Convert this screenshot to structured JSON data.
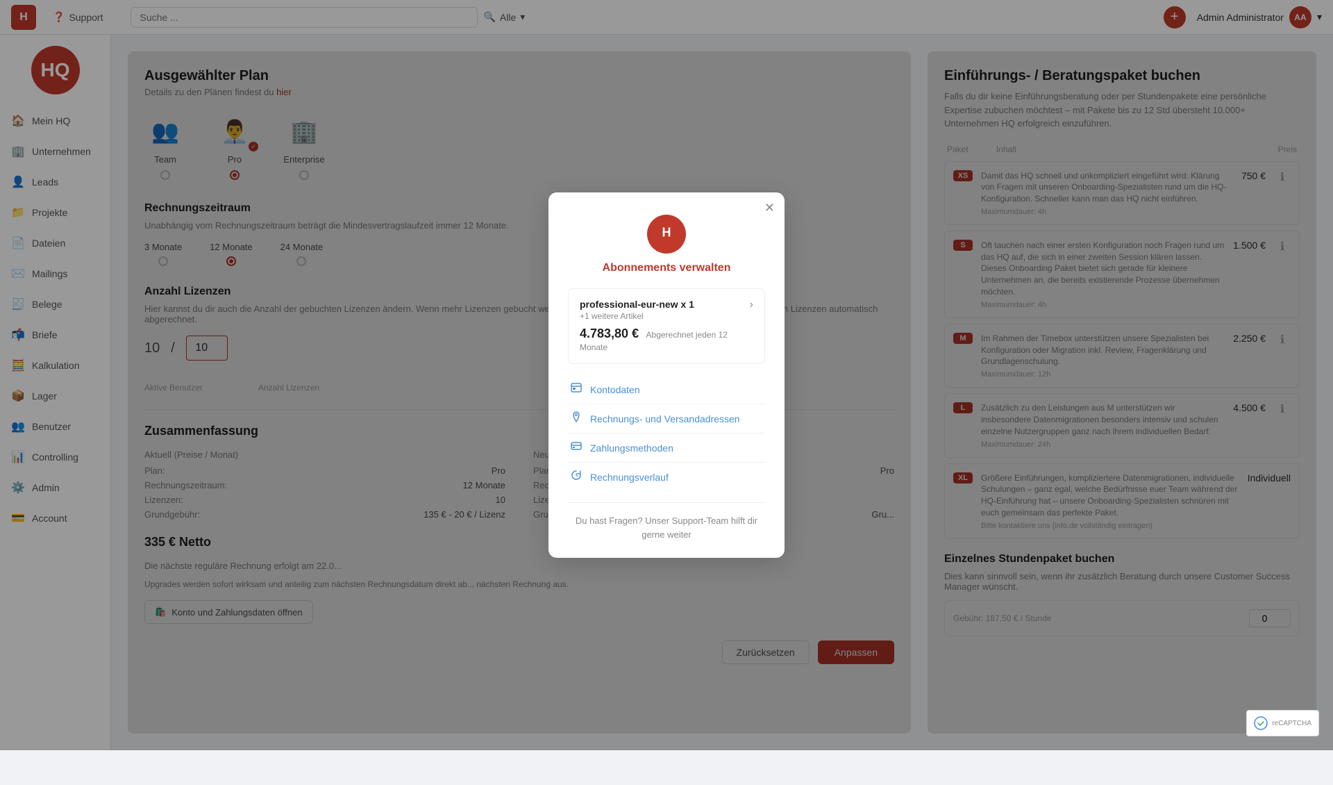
{
  "app": {
    "logo_text": "HQ",
    "logo_text_small": "H"
  },
  "topnav": {
    "support_label": "Support",
    "search_placeholder": "Suche ...",
    "search_filter_label": "Alle",
    "add_button_label": "+",
    "user_name": "Admin Administrator",
    "user_initials": "AA"
  },
  "sidebar": {
    "logo_text": "HQ.",
    "items": [
      {
        "id": "mein-hq",
        "label": "Mein HQ",
        "icon": "🏠"
      },
      {
        "id": "unternehmen",
        "label": "Unternehmen",
        "icon": "🏢"
      },
      {
        "id": "leads",
        "label": "Leads",
        "icon": "👤",
        "active": true
      },
      {
        "id": "projekte",
        "label": "Projekte",
        "icon": "📁"
      },
      {
        "id": "dateien",
        "label": "Dateien",
        "icon": "📄"
      },
      {
        "id": "mailings",
        "label": "Mailings",
        "icon": "✉️"
      },
      {
        "id": "belege",
        "label": "Belege",
        "icon": "🧾"
      },
      {
        "id": "briefe",
        "label": "Briefe",
        "icon": "📬"
      },
      {
        "id": "kalkulation",
        "label": "Kalkulation",
        "icon": "🧮"
      },
      {
        "id": "lager",
        "label": "Lager",
        "icon": "📦"
      },
      {
        "id": "benutzer",
        "label": "Benutzer",
        "icon": "👥"
      },
      {
        "id": "controlling",
        "label": "Controlling",
        "icon": "📊"
      },
      {
        "id": "admin",
        "label": "Admin",
        "icon": "⚙️"
      },
      {
        "id": "account",
        "label": "Account",
        "icon": "💳"
      }
    ]
  },
  "left_panel": {
    "title": "Ausgewählter Plan",
    "subtitle_text": "Details zu den Plänen findest du",
    "subtitle_link": "hier",
    "plans": [
      {
        "id": "team",
        "label": "Team",
        "icon": "👥",
        "selected": false
      },
      {
        "id": "pro",
        "label": "Pro",
        "icon": "👨‍💼",
        "selected": true
      },
      {
        "id": "enterprise",
        "label": "Enterprise",
        "icon": "🏢",
        "selected": false
      }
    ],
    "billing_period_title": "Rechnungszeitraum",
    "billing_period_desc": "Unabhängig vom Rechnungszeitraum beträgt die Mindesvertragslaufzeit immer 12 Monate.",
    "billing_periods": [
      {
        "id": "3months",
        "label": "3 Monate",
        "selected": false
      },
      {
        "id": "12months",
        "label": "12 Monate",
        "selected": true
      },
      {
        "id": "24months",
        "label": "24 Monate",
        "selected": false
      }
    ],
    "license_title": "Anzahl Lizenzen",
    "license_desc": "Hier kannst du dir auch die Anzahl der gebuchten Lizenzen ändern. Wenn mehr Lizenzen gebucht werden als Benutzer vorhanden sind, werden die überzähligen Lizenzen automatisch abgerechnet.",
    "active_users": "10",
    "license_count": "10",
    "active_users_label": "Aktive Benutzer",
    "license_count_label": "Anzahl Lizenzen",
    "summary_title": "Zusammenfassung",
    "current_col_title": "Aktuell (Preise / Monat)",
    "new_col_title": "Neu (Preise / Monat)",
    "current_plan_label": "Plan:",
    "current_plan_value": "Pro",
    "current_period_label": "Rechnungszeitraum:",
    "current_period_value": "12 Monate",
    "current_licenses_label": "Lizenzen:",
    "current_licenses_value": "10",
    "current_base_label": "Grundgebühr:",
    "current_base_value": "135 € - 20 € / Lizenz",
    "new_plan_label": "Plan:",
    "new_plan_value": "Pro",
    "new_period_label": "Rechnungszeitraum:",
    "new_period_value": "",
    "new_licenses_label": "Lizenzen:",
    "new_licenses_value": "",
    "new_base_label": "Grundgebühr:",
    "new_base_value": "Gru...",
    "total": "335 € Netto",
    "next_invoice_text": "Die nächste reguläre Rechnung erfolgt am 22.0...",
    "upgrade_note": "Upgrades werden sofort wirksam und anteilig zum nächsten Rechnungsdatum direkt ab... nächsten Rechnung aus.",
    "konto_btn_label": "Konto und Zahlungsdaten öffnen",
    "btn_reset": "Zurücksetzen",
    "btn_save": "Anpassen"
  },
  "right_panel": {
    "title": "Einführungs- / Beratungspaket buchen",
    "desc": "Falls du dir keine Einführungsberatung oder per Stundenpakete eine persönliche Expertise zubuchen möchtest – mit Pakete bis zu 12 Std übersteht 10.000+ Unternehmen HQ erfolgreich einzuführen.",
    "table_headers": [
      "Paket",
      "Inhalt",
      "Preis"
    ],
    "packages": [
      {
        "badge": "XS",
        "title": "Damit das HQ schnell und unkompliziert eingeführt wird: Klärung von Fragen mit unseren Onboarding-Spezialisten rund um die HQ-Konfiguration. Schneller kann man das HQ nicht einführen.",
        "max": "Maximumdauer: 4h",
        "price": "750 €",
        "color": "#c0392b"
      },
      {
        "badge": "S",
        "title": "Oft tauchen nach einer ersten Konfiguration noch Fragen rund um das HQ auf, die sich in einer zweiten Session klären lassen. Dieses Onboarding Paket bietet sich gerade für kleinere Unternehmen an, die bereits existierende Prozesse übernehmen möchten.",
        "max": "Maximumdauer: 4h",
        "price": "1.500 €",
        "color": "#c0392b"
      },
      {
        "badge": "M",
        "title": "Im Rahmen der Timebox unterstützen unsere Spezialisten bei Konfiguration oder Migration inkl. Review, Fragenklärung und Grundlagenschulung.",
        "max": "Maximumdauer: 12h",
        "price": "2.250 €",
        "color": "#c0392b"
      },
      {
        "badge": "L",
        "title": "Zusätzlich zu den Leistungen aus M unterstützen wir insbesondere Datenmigrationen besonders intensiv und schulen einzelne Nutzergruppen ganz nach ihrem individuellen Bedarf.",
        "max": "Maximumdauer: 24h",
        "price": "4.500 €",
        "color": "#c0392b"
      },
      {
        "badge": "XL",
        "title": "Größere Einführungen, kompliziertere Datenmigrationen, individuelle Schulungen – ganz egal, welche Bedürfnisse euer Team während der HQ-Einführung hat – unsere Onboarding-Spezialisten schnüren mit euch gemeinsam das perfekte Paket.",
        "max": "Bitte kontaktiere uns (info.de vollständig eintragen)",
        "price": "Individuell",
        "color": "#c0392b"
      }
    ],
    "single_hours_title": "Einzelnes Stundenpaket buchen",
    "single_hours_desc": "Dies kann sinnvoll sein, wenn ihr zusätzlich Beratung durch unsere Customer Success Manager wünscht.",
    "single_hours_sub": "Gebühr: 187,50 € / Stunde",
    "hours_input_value": "0"
  },
  "modal": {
    "logo_text": "H",
    "title": "Abonnements verwalten",
    "subscription": {
      "name": "professional-eur-new x 1",
      "extra": "+1 weitere Artikel",
      "price": "4.783,80 €",
      "period": "Abgerechnet jeden 12 Monate"
    },
    "menu_items": [
      {
        "id": "kontodaten",
        "label": "Kontodaten",
        "icon": "📋"
      },
      {
        "id": "rechnungs-versand",
        "label": "Rechnungs- und Versandadressen",
        "icon": "📍"
      },
      {
        "id": "zahlungsmethoden",
        "label": "Zahlungsmethoden",
        "icon": "💳"
      },
      {
        "id": "rechnungsverlauf",
        "label": "Rechnungsverlauf",
        "icon": "🔄"
      }
    ],
    "footer_text": "Du hast Fragen? Unser Support-Team hilft dir gerne weiter"
  },
  "recaptcha": {
    "label": "reCAPTCHA"
  }
}
